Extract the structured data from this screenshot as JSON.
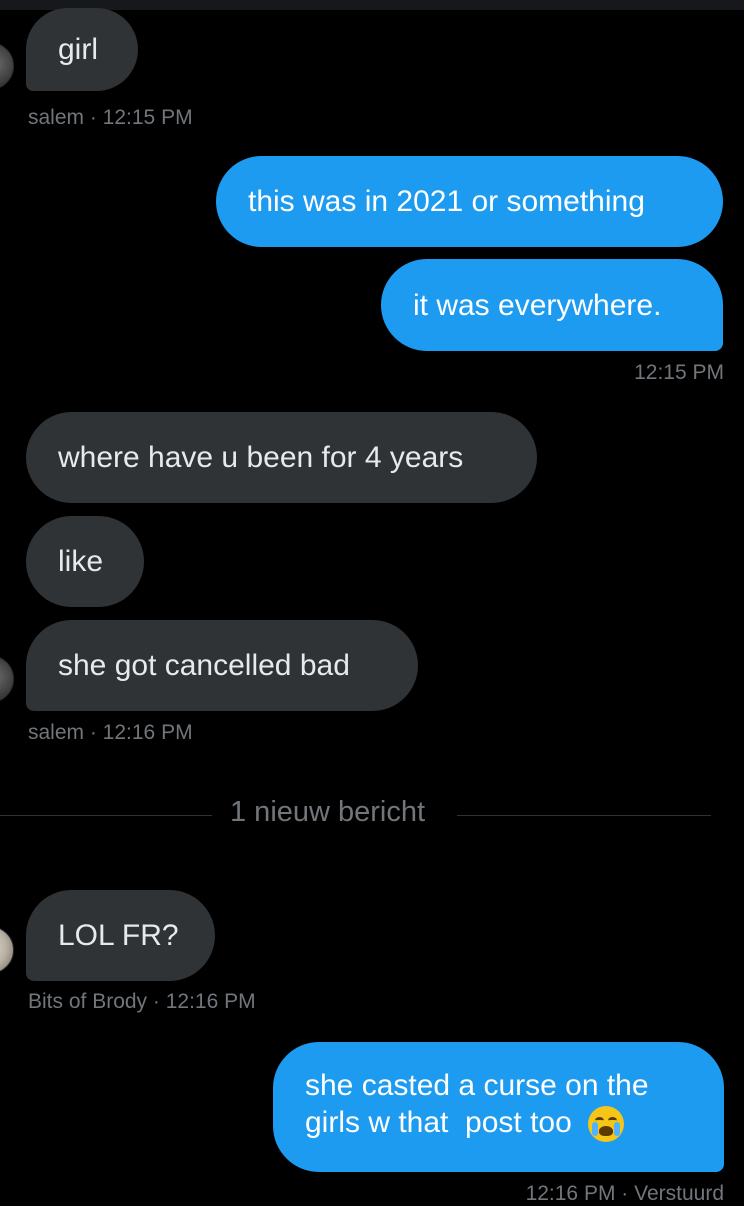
{
  "conversation": {
    "messages": [
      {
        "text": "girl"
      },
      {
        "text": "this was in 2021 or something"
      },
      {
        "text": "it was everywhere."
      },
      {
        "text": "where have u been for 4 years"
      },
      {
        "text": "like"
      },
      {
        "text": "she got cancelled bad"
      },
      {
        "text": "LOL FR?"
      },
      {
        "line1": "she casted a curse on the",
        "line2": "girls w that  post too",
        "emoji": "loudly-crying-face-emoji"
      }
    ],
    "meta": {
      "salem_1": "salem · 12:15 PM",
      "sent_1": "12:15 PM",
      "salem_2": "salem · 12:16 PM",
      "brody": "Bits of Brody · 12:16 PM",
      "sent_2": "12:16 PM · Verstuurd"
    },
    "divider": "1 nieuw bericht"
  }
}
